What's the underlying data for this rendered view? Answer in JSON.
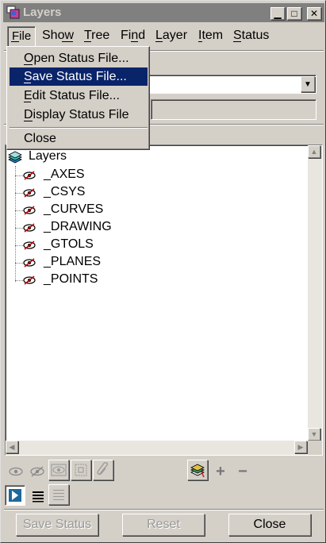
{
  "window": {
    "title": "Layers"
  },
  "titlebar_buttons": {
    "minimize": "▁",
    "maximize": "□",
    "close": "✕"
  },
  "menubar": {
    "items": [
      {
        "label": "File",
        "accel": "F"
      },
      {
        "label": "Show",
        "accel": "w"
      },
      {
        "label": "Tree",
        "accel": "T"
      },
      {
        "label": "Find",
        "accel": "n"
      },
      {
        "label": "Layer",
        "accel": "L"
      },
      {
        "label": "Item",
        "accel": "I"
      },
      {
        "label": "Status",
        "accel": "S"
      }
    ]
  },
  "file_menu": {
    "items": [
      {
        "label": "Open Status File...",
        "selected": false
      },
      {
        "label": "Save Status File...",
        "selected": true
      },
      {
        "label": "Edit Status File...",
        "selected": false
      },
      {
        "label": "Display Status File",
        "selected": false
      }
    ],
    "close_label": "Close"
  },
  "tree": {
    "root_label": "Layers",
    "layers": [
      "_AXES",
      "_CSYS",
      "_CURVES",
      "_DRAWING",
      "_GTOLS",
      "_PLANES",
      "_POINTS"
    ]
  },
  "toolbar": {
    "icons": [
      "eye-icon",
      "hidden-eye-icon",
      "isolate-icon",
      "blank-icon",
      "paperclip-icon",
      "new-layer-icon",
      "plus-icon",
      "minus-icon"
    ],
    "plus_glyph": "+",
    "minus_glyph": "−"
  },
  "buttons": {
    "save_status": "Save Status",
    "reset": "Reset",
    "close": "Close"
  },
  "colors": {
    "selection": "#0a246a",
    "face": "#d4d0c8",
    "title_inactive": "#808080"
  }
}
